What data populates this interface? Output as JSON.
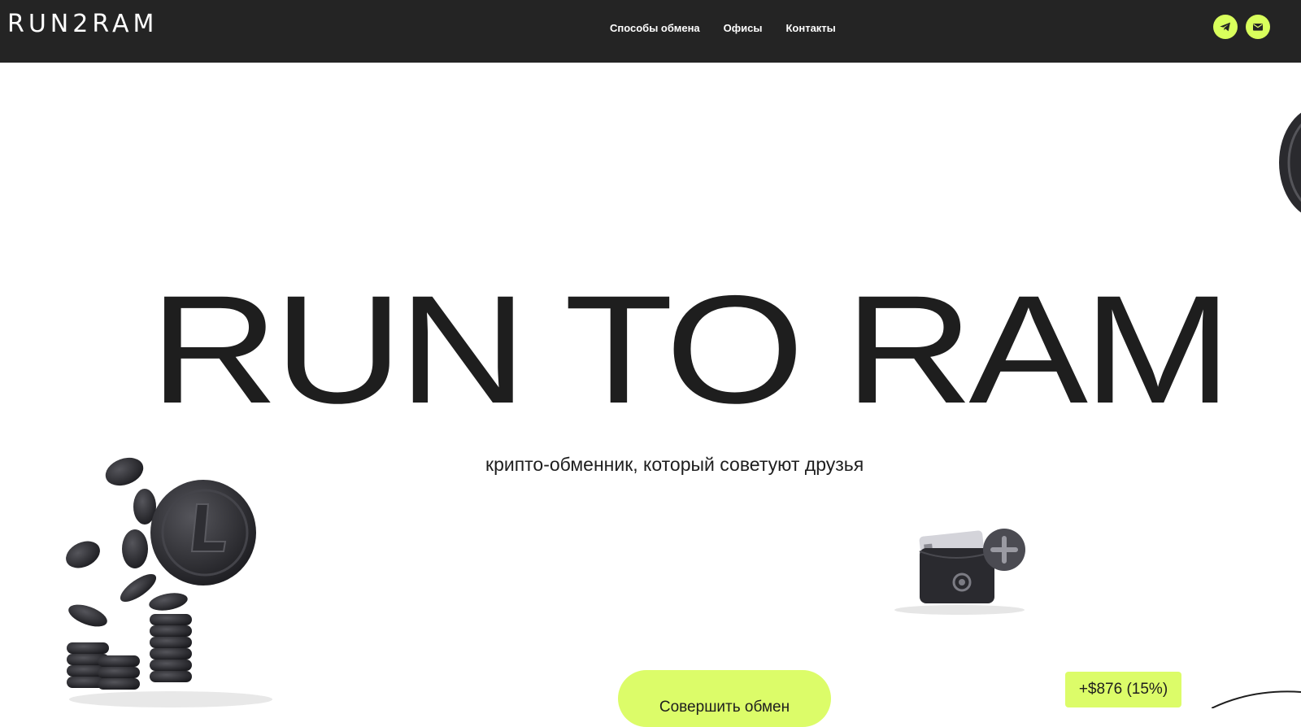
{
  "header": {
    "logo": "RUN2RAM",
    "nav": [
      {
        "label": "Способы обмена"
      },
      {
        "label": "Офисы"
      },
      {
        "label": "Контакты"
      }
    ],
    "social": [
      {
        "icon": "telegram-icon"
      },
      {
        "icon": "mail-icon"
      }
    ]
  },
  "hero": {
    "title": "RUN TO RAM",
    "subtitle": "крипто-обменник, который советуют друзья",
    "cta_label": "Совершить обмен",
    "gain_badge": "+$876 (15%)"
  },
  "colors": {
    "header_bg": "#242424",
    "accent": "#dcfc69",
    "text": "#1e1e1e"
  }
}
